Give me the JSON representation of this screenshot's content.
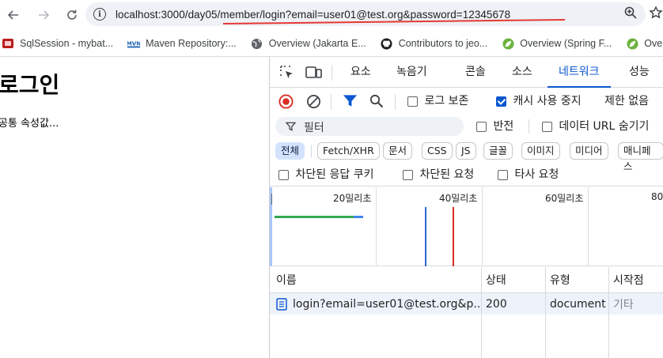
{
  "browser": {
    "url": "localhost:3000/day05/member/login?email=user01@test.org&password=12345678",
    "colors": {
      "annotation": "#e53935",
      "accent": "#0b57d0"
    }
  },
  "bookmarks": [
    {
      "label": "SqlSession - mybat...",
      "icon": "sqlsession-favicon"
    },
    {
      "label": "Maven Repository:...",
      "icon": "maven-favicon"
    },
    {
      "label": "Overview (Jakarta E...",
      "icon": "globe-icon"
    },
    {
      "label": "Contributors to jeo...",
      "icon": "github-icon"
    },
    {
      "label": "Overview (Spring F...",
      "icon": "spring-leaf-icon"
    },
    {
      "label": "Overview (",
      "icon": "spring-leaf-icon"
    }
  ],
  "page": {
    "heading": "로그인",
    "text": "공통 속성값..."
  },
  "devtools": {
    "tabs": [
      "요소",
      "녹음기",
      "콘솔",
      "소스",
      "네트워크",
      "성능"
    ],
    "active_tab": "네트워크",
    "toolbar": {
      "preserve_log": "로그 보존",
      "disable_cache": "캐시 사용 중지",
      "throttle": "제한 없음"
    },
    "filter": {
      "placeholder": "필터",
      "invert": "반전",
      "hide_data_urls": "데이터 URL 숨기기"
    },
    "type_chips": [
      "전체",
      "Fetch/XHR",
      "문서",
      "CSS",
      "JS",
      "글꼴",
      "이미지",
      "미디어",
      "매니페스"
    ],
    "options": [
      "차단된 응답 쿠키",
      "차단된 요청",
      "타사 요청"
    ],
    "timeline_ticks": [
      "20밀리초",
      "40밀리초",
      "60밀리초",
      "80"
    ],
    "table": {
      "headers": [
        "이름",
        "상태",
        "유형",
        "시작점"
      ],
      "rows": [
        {
          "name": "login?email=user01@test.org&p...",
          "status": "200",
          "type": "document",
          "initiator": "기타"
        }
      ]
    }
  }
}
